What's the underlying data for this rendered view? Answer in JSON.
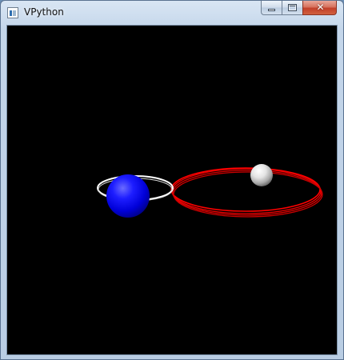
{
  "window": {
    "title": "VPython",
    "icon": "vpython-app-icon",
    "controls": {
      "minimize_icon": "minimize-icon",
      "maximize_icon": "maximize-icon",
      "close_icon": "close-icon",
      "close_glyph": "✕"
    }
  },
  "scene": {
    "background_color": "#000000",
    "objects": [
      {
        "name": "blue-planet",
        "color": "#0000ff"
      },
      {
        "name": "white-moon",
        "color": "#ffffff"
      },
      {
        "name": "white-orbit-trail",
        "color": "#ffffff"
      },
      {
        "name": "red-orbit-trail",
        "color": "#ff0000"
      }
    ]
  }
}
